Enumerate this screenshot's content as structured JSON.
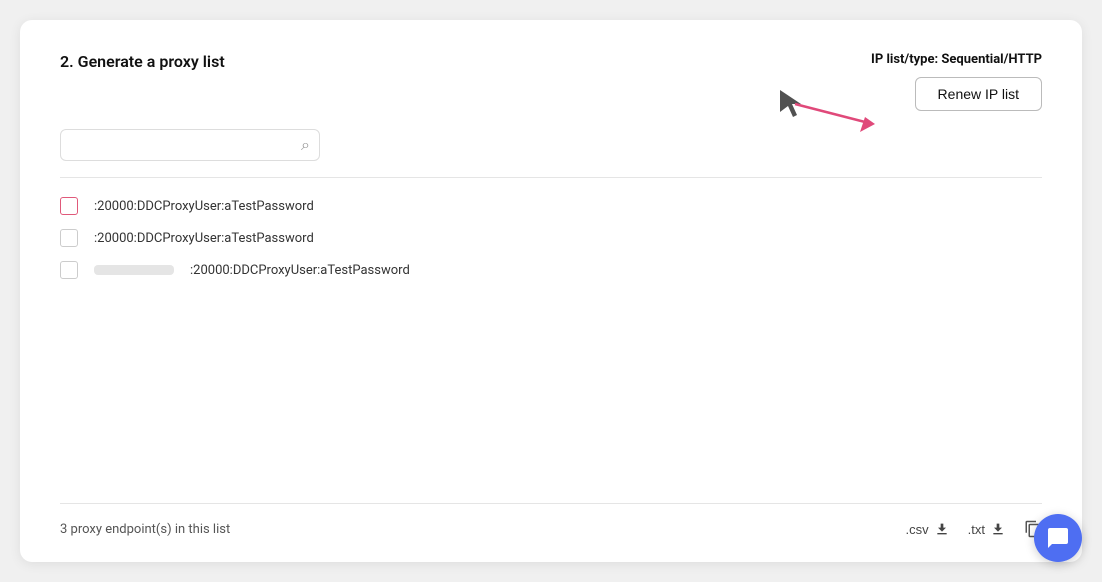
{
  "card": {
    "section_title": "2. Generate a proxy list",
    "ip_type_prefix": "IP list/type:",
    "ip_type_value": "Sequential/HTTP",
    "renew_button_label": "Renew IP list",
    "search_placeholder": "",
    "proxy_rows": [
      {
        "id": 1,
        "ip_visible": true,
        "ip_text": "",
        "suffix": ":20000:DDCProxyUser:aTestPassword",
        "checked": false,
        "highlighted": true
      },
      {
        "id": 2,
        "ip_visible": true,
        "ip_text": "",
        "suffix": ":20000:DDCProxyUser:aTestPassword",
        "checked": false,
        "highlighted": false
      },
      {
        "id": 3,
        "ip_visible": false,
        "ip_text": "",
        "suffix": ":20000:DDCProxyUser:aTestPassword",
        "checked": false,
        "highlighted": false
      }
    ],
    "footer": {
      "count_label": "3 proxy endpoint(s) in this list",
      "csv_label": ".csv",
      "txt_label": ".txt"
    }
  }
}
